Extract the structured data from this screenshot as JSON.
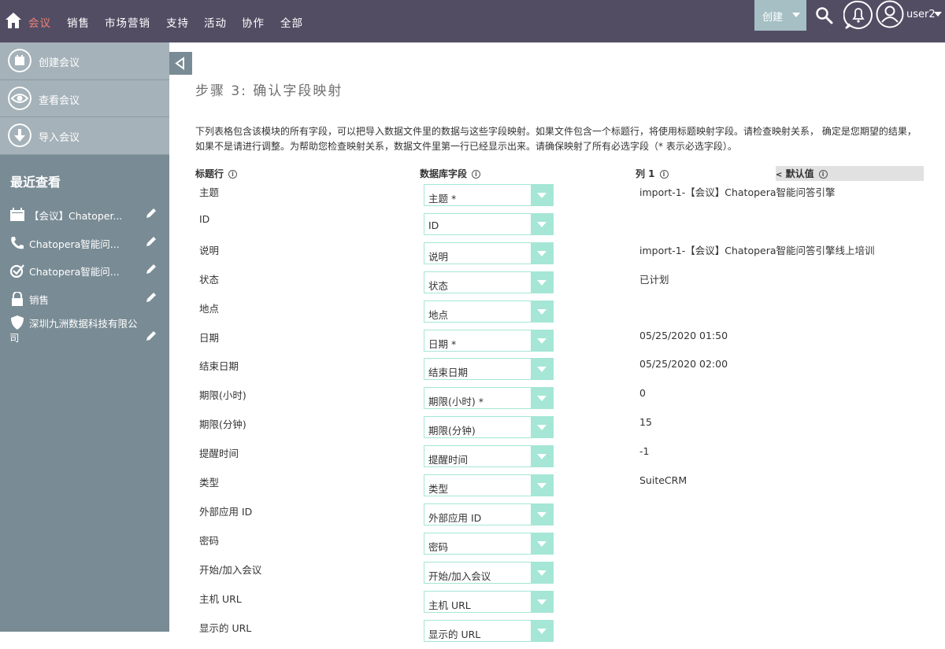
{
  "nav": {
    "items": [
      "会议",
      "销售",
      "市场营销",
      "支持",
      "活动",
      "协作",
      "全部"
    ],
    "create_label": "创建",
    "user_name": "user2"
  },
  "sidebar": {
    "actions": [
      {
        "label": "创建会议",
        "icon": "calendar-icon"
      },
      {
        "label": "查看会议",
        "icon": "eye-icon"
      },
      {
        "label": "导入会议",
        "icon": "download-icon"
      }
    ],
    "recent_title": "最近查看",
    "recent": [
      {
        "label": "【会议】Chatoper...",
        "icon": "calendar-icon"
      },
      {
        "label": "Chatopera智能问...",
        "icon": "phone-icon"
      },
      {
        "label": "Chatopera智能问...",
        "icon": "task-icon"
      },
      {
        "label": "销售",
        "icon": "lock-icon"
      },
      {
        "label": "深圳九洲数据科技有限公",
        "label2": "司",
        "icon": "shield-icon"
      }
    ]
  },
  "main": {
    "step_title": "步骤 3:  确认字段映射",
    "description": "下列表格包含该模块的所有字段，可以把导入数据文件里的数据与这些字段映射。如果文件包含一个标题行，将使用标题映射字段。请检查映射关系， 确定是您期望的结果，如果不是请进行调整。为帮助您检查映射关系，数据文件里第一行已经显示出来。请确保映射了所有必选字段（* 表示必选字段）。",
    "headers": {
      "header_row": "标题行",
      "db_field": "数据库字段",
      "column1": "列 1",
      "default_value": "默认值"
    },
    "rows": [
      {
        "label": "主题",
        "field": "主题 *",
        "sample": "import-1-【会议】Chatopera智能问答引擎"
      },
      {
        "label": "ID",
        "field": "ID",
        "sample": ""
      },
      {
        "label": "说明",
        "field": "说明",
        "sample": "import-1-【会议】Chatopera智能问答引擎线上培训"
      },
      {
        "label": "状态",
        "field": "状态",
        "sample": "已计划"
      },
      {
        "label": "地点",
        "field": "地点",
        "sample": ""
      },
      {
        "label": "日期",
        "field": "日期 *",
        "sample": "05/25/2020 01:50"
      },
      {
        "label": "结束日期",
        "field": "结束日期",
        "sample": "05/25/2020 02:00"
      },
      {
        "label": "期限(小时)",
        "field": "期限(小时) *",
        "sample": "0"
      },
      {
        "label": "期限(分钟)",
        "field": "期限(分钟)",
        "sample": "15"
      },
      {
        "label": "提醒时间",
        "field": "提醒时间",
        "sample": "-1"
      },
      {
        "label": "类型",
        "field": "类型",
        "sample": "SuiteCRM"
      },
      {
        "label": "外部应用 ID",
        "field": "外部应用 ID",
        "sample": ""
      },
      {
        "label": "密码",
        "field": "密码",
        "sample": ""
      },
      {
        "label": "开始/加入会议",
        "field": "开始/加入会议",
        "sample": ""
      },
      {
        "label": "主机 URL",
        "field": "主机 URL",
        "sample": ""
      },
      {
        "label": "显示的 URL",
        "field": "显示的 URL",
        "sample": ""
      }
    ]
  },
  "colors": {
    "topbar": "#534d64",
    "active_nav": "#f08377",
    "sidebar": "#798b94",
    "sidebar_actions": "#a5b2b9",
    "select_accent": "#a5e6d6"
  }
}
